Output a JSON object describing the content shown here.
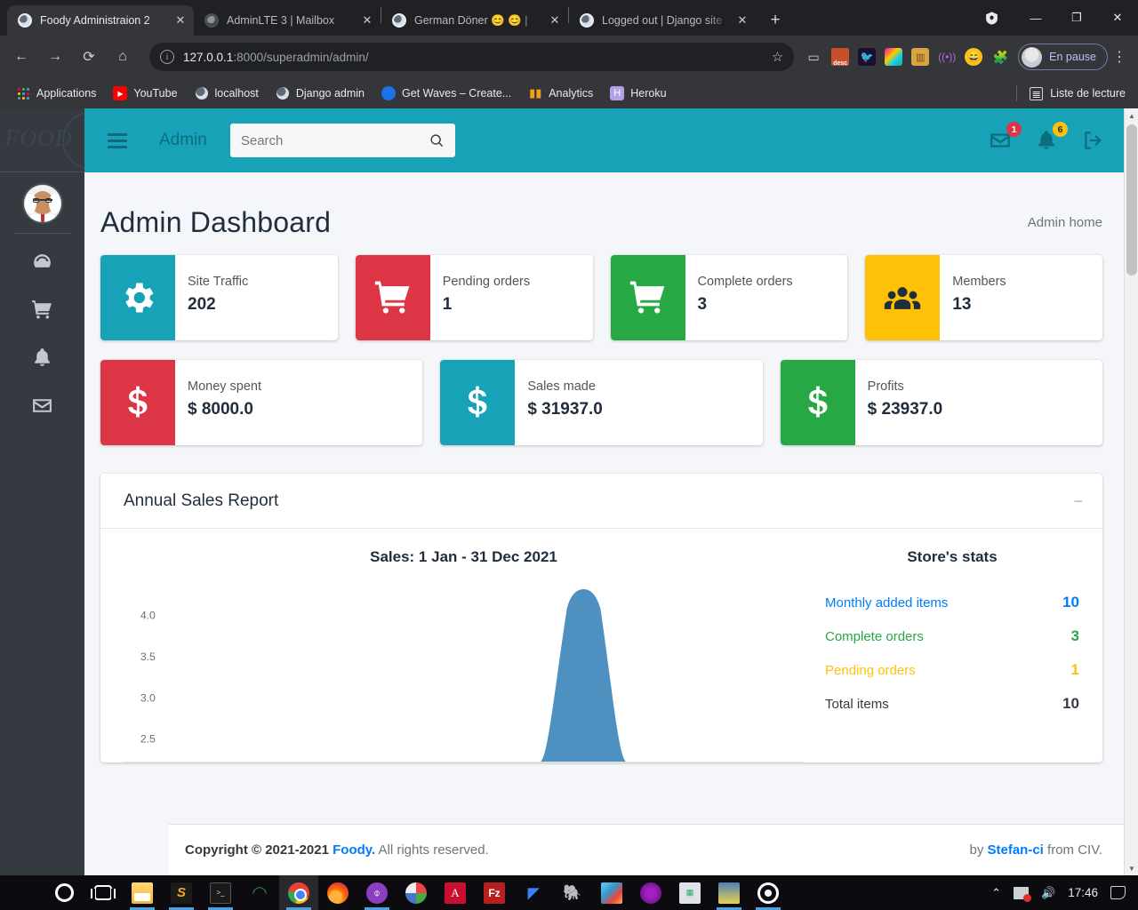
{
  "browser": {
    "tabs": [
      {
        "title": "Foody Administraion 2",
        "favicon": "django-icon",
        "active": true
      },
      {
        "title": "AdminLTE 3 | Mailbox",
        "favicon": "adminlte-icon",
        "active": false
      },
      {
        "title": "German Döner 😊 😊 |",
        "favicon": "django-icon",
        "active": false
      },
      {
        "title": "Logged out | Django site",
        "favicon": "django-icon",
        "active": false
      }
    ],
    "new_tab_label": "+",
    "close_label": "✕",
    "window_controls": {
      "minimize": "—",
      "maximize": "❐",
      "close": "✕"
    },
    "nav": {
      "back": "←",
      "forward": "→",
      "reload": "⟳",
      "home": "⌂"
    },
    "url": {
      "host": "127.0.0.1",
      "path": ":8000/superadmin/admin/"
    },
    "star": "☆",
    "profile_label": "En pause",
    "kebab": "⋮",
    "bookmarks": [
      {
        "label": "Applications",
        "icon": "apps-grid-icon"
      },
      {
        "label": "YouTube",
        "icon": "youtube-icon"
      },
      {
        "label": "localhost",
        "icon": "django-icon"
      },
      {
        "label": "Django admin",
        "icon": "django-icon"
      },
      {
        "label": "Get Waves – Create...",
        "icon": "wave-icon"
      },
      {
        "label": "Analytics",
        "icon": "analytics-icon"
      },
      {
        "label": "Heroku",
        "icon": "heroku-icon"
      }
    ],
    "reading_list": "Liste de lecture"
  },
  "sidebar": {
    "brand": "FOOD",
    "items": [
      {
        "name": "dashboard",
        "icon": "tachometer-icon"
      },
      {
        "name": "orders",
        "icon": "cart-icon"
      },
      {
        "name": "notifications",
        "icon": "bell-icon"
      },
      {
        "name": "messages",
        "icon": "envelope-icon"
      }
    ]
  },
  "navbar": {
    "brand": "Admin",
    "search_placeholder": "Search",
    "search_value": "",
    "messages_badge": "1",
    "notifications_badge": "6"
  },
  "header": {
    "title": "Admin Dashboard",
    "breadcrumb": "Admin home"
  },
  "stats_row1": [
    {
      "label": "Site Traffic",
      "value": "202",
      "icon": "gear-icon",
      "color": "#17a2b8"
    },
    {
      "label": "Pending orders",
      "value": "1",
      "icon": "cart-icon",
      "color": "#dc3545"
    },
    {
      "label": "Complete orders",
      "value": "3",
      "icon": "cart-icon",
      "color": "#28a745"
    },
    {
      "label": "Members",
      "value": "13",
      "icon": "users-icon",
      "color": "#ffc107"
    }
  ],
  "stats_row2": [
    {
      "label": "Money spent",
      "value": "$ 8000.0",
      "icon": "dollar-icon",
      "color": "#dc3545"
    },
    {
      "label": "Sales made",
      "value": "$ 31937.0",
      "icon": "dollar-icon",
      "color": "#17a2b8"
    },
    {
      "label": "Profits",
      "value": "$ 23937.0",
      "icon": "dollar-icon",
      "color": "#28a745"
    }
  ],
  "report": {
    "title": "Annual Sales Report",
    "collapse_icon": "−",
    "stats_heading": "Store's stats",
    "store_stats": [
      {
        "label": "Monthly added items",
        "value": "10",
        "color": "#007bff"
      },
      {
        "label": "Complete orders",
        "value": "3",
        "color": "#28a745"
      },
      {
        "label": "Pending orders",
        "value": "1",
        "color": "#ffc107"
      },
      {
        "label": "Total items",
        "value": "10",
        "color": "#343a40"
      }
    ]
  },
  "chart_data": {
    "type": "area",
    "title": "Sales: 1 Jan - 31 Dec 2021",
    "xlabel": "",
    "ylabel": "",
    "yticks": [
      "4.0",
      "3.5",
      "3.0",
      "2.5"
    ],
    "ylim": [
      2.3,
      4.15
    ],
    "grid": false,
    "legend": null,
    "series_color": "#4e90c0",
    "series": [
      {
        "name": "Sales",
        "x": [
          0,
          1,
          2,
          3,
          4,
          5,
          6,
          7,
          8,
          9,
          10,
          11
        ],
        "values": [
          0,
          0,
          0,
          0,
          0,
          0,
          4.0,
          0,
          0,
          0,
          0,
          0
        ]
      }
    ],
    "peak": {
      "x_position_pct": 64,
      "y_value": 4.0
    }
  },
  "footer": {
    "copyright_prefix": "Copyright © 2021-2021",
    "brand": "Foody.",
    "copyright_suffix": "All rights reserved.",
    "by_prefix": "by",
    "author": "Stefan-ci",
    "by_suffix": "from CIV."
  },
  "taskbar": {
    "items": [
      {
        "name": "start",
        "icon": "windows-icon"
      },
      {
        "name": "cortana",
        "icon": "circle-icon"
      },
      {
        "name": "task-view",
        "icon": "taskview-icon"
      },
      {
        "name": "file-explorer",
        "icon": "folder-icon"
      },
      {
        "name": "sublime-text",
        "icon": "sublime-icon"
      },
      {
        "name": "terminal",
        "icon": "terminal-icon"
      },
      {
        "name": "pgadmin",
        "icon": "pgadmin-icon"
      },
      {
        "name": "chrome",
        "icon": "chrome-icon"
      },
      {
        "name": "firefox",
        "icon": "firefox-icon"
      },
      {
        "name": "github-desktop",
        "icon": "github-icon"
      },
      {
        "name": "photos",
        "icon": "photos-icon"
      },
      {
        "name": "acrobat-reader",
        "icon": "pdf-icon"
      },
      {
        "name": "filezilla",
        "icon": "filezilla-icon"
      },
      {
        "name": "visual-studio",
        "icon": "vs-icon"
      },
      {
        "name": "postgresql",
        "icon": "postgres-icon"
      },
      {
        "name": "winrar",
        "icon": "winrar-icon"
      },
      {
        "name": "tor-browser",
        "icon": "tor-icon"
      },
      {
        "name": "system-monitor",
        "icon": "monitor-icon"
      },
      {
        "name": "pgsql-tool",
        "icon": "pgsql-icon"
      },
      {
        "name": "spiral-app",
        "icon": "spiral-icon"
      }
    ],
    "tray": {
      "chevron": "⌃",
      "network_status": "disconnected",
      "volume": "🔊",
      "clock": "17:46"
    }
  }
}
